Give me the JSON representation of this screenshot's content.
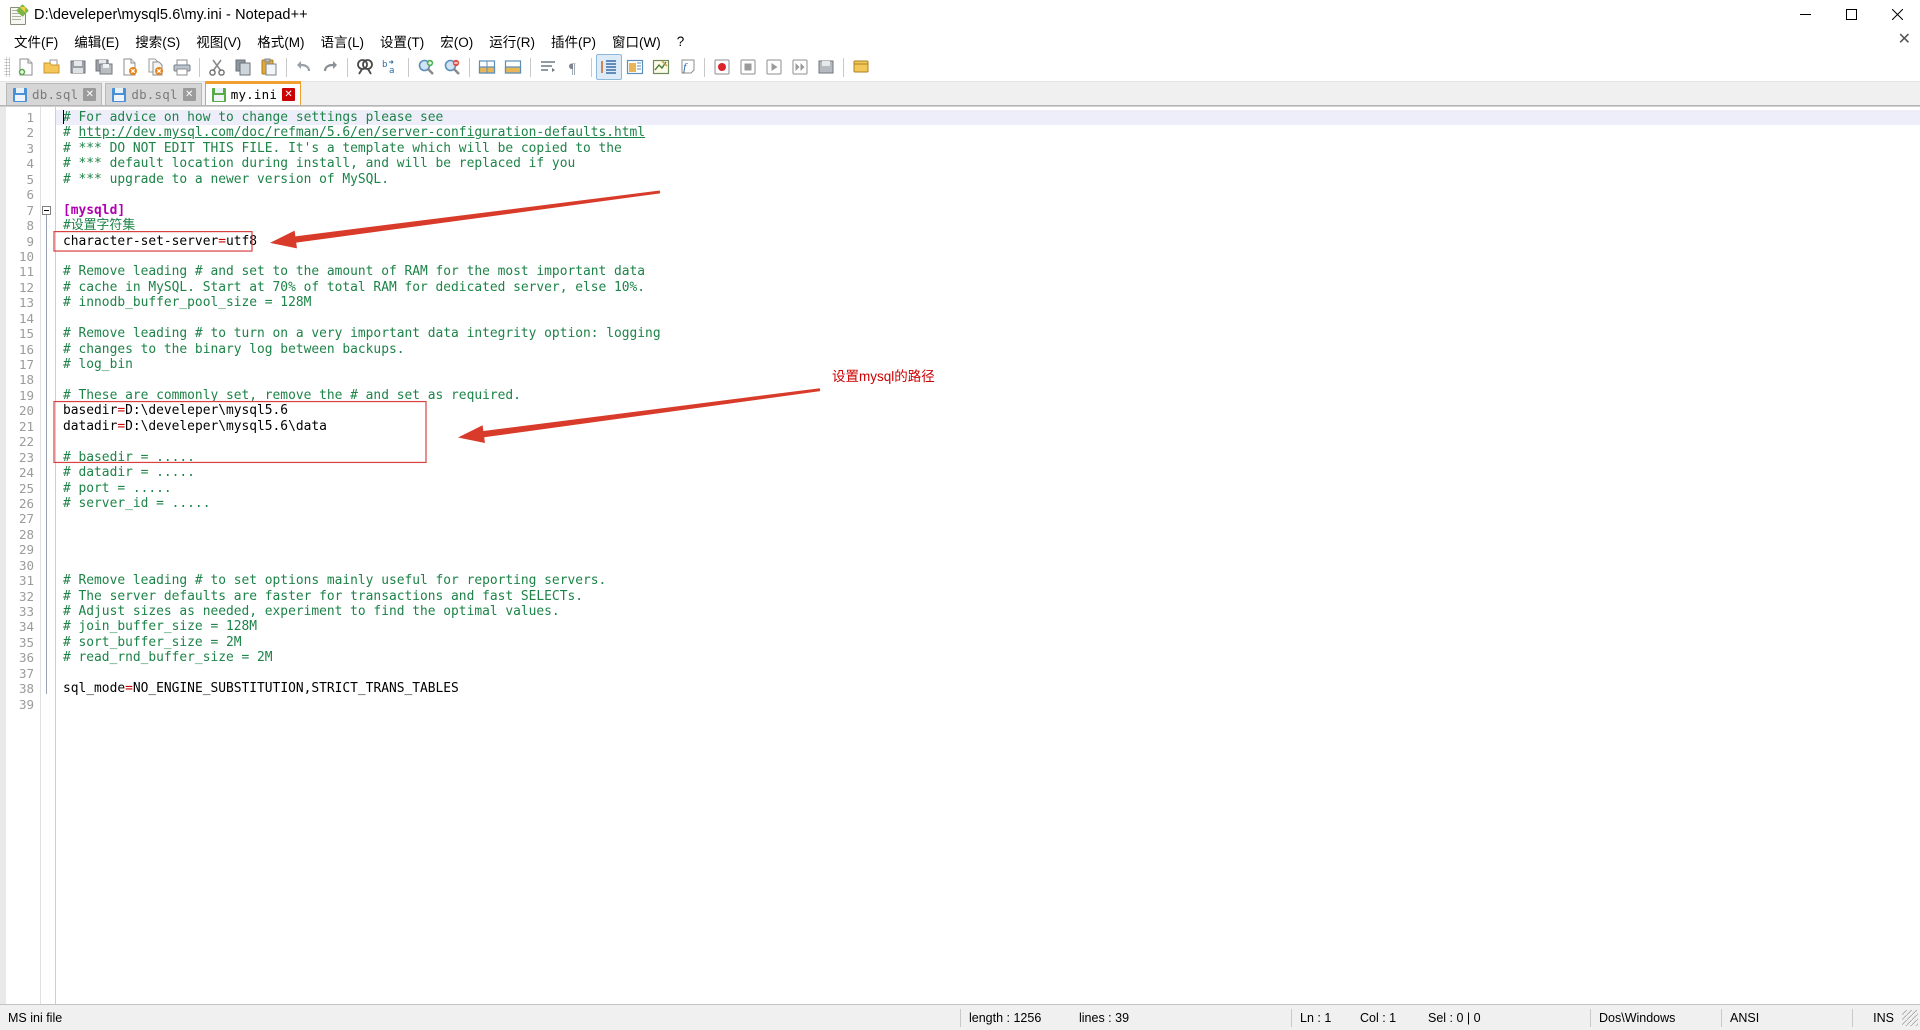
{
  "window": {
    "title": "D:\\develeper\\mysql5.6\\my.ini - Notepad++",
    "icon": "notepad-plus-plus-icon",
    "minimize_label": "—",
    "maximize_label": "❐",
    "close_label": "✕"
  },
  "menubar": {
    "items": [
      {
        "label": "文件(F)",
        "name": "menu-file"
      },
      {
        "label": "编辑(E)",
        "name": "menu-edit"
      },
      {
        "label": "搜索(S)",
        "name": "menu-search"
      },
      {
        "label": "视图(V)",
        "name": "menu-view"
      },
      {
        "label": "格式(M)",
        "name": "menu-format"
      },
      {
        "label": "语言(L)",
        "name": "menu-language"
      },
      {
        "label": "设置(T)",
        "name": "menu-settings"
      },
      {
        "label": "宏(O)",
        "name": "menu-macro"
      },
      {
        "label": "运行(R)",
        "name": "menu-run"
      },
      {
        "label": "插件(P)",
        "name": "menu-plugins"
      },
      {
        "label": "窗口(W)",
        "name": "menu-window"
      },
      {
        "label": "?",
        "name": "menu-help"
      }
    ],
    "close_doc_label": "✕"
  },
  "toolbar": {
    "buttons": [
      {
        "name": "new-file-icon",
        "glyph": "new"
      },
      {
        "name": "open-file-icon",
        "glyph": "open"
      },
      {
        "name": "save-icon",
        "glyph": "save"
      },
      {
        "name": "save-all-icon",
        "glyph": "saveall"
      },
      {
        "name": "close-document-icon",
        "glyph": "closedoc"
      },
      {
        "name": "close-all-documents-icon",
        "glyph": "closeall"
      },
      {
        "name": "print-icon",
        "glyph": "print"
      },
      {
        "name": "separator",
        "glyph": "sep"
      },
      {
        "name": "cut-icon",
        "glyph": "cut"
      },
      {
        "name": "copy-icon",
        "glyph": "copy"
      },
      {
        "name": "paste-icon",
        "glyph": "paste"
      },
      {
        "name": "separator",
        "glyph": "sep"
      },
      {
        "name": "undo-icon",
        "glyph": "undo"
      },
      {
        "name": "redo-icon",
        "glyph": "redo"
      },
      {
        "name": "separator",
        "glyph": "sep"
      },
      {
        "name": "find-icon",
        "glyph": "find"
      },
      {
        "name": "replace-icon",
        "glyph": "replace"
      },
      {
        "name": "separator",
        "glyph": "sep"
      },
      {
        "name": "zoom-in-icon",
        "glyph": "zoomin"
      },
      {
        "name": "zoom-out-icon",
        "glyph": "zoomout"
      },
      {
        "name": "separator",
        "glyph": "sep"
      },
      {
        "name": "sync-vertical-scroll-icon",
        "glyph": "syncv"
      },
      {
        "name": "sync-horizontal-scroll-icon",
        "glyph": "synch"
      },
      {
        "name": "separator",
        "glyph": "sep"
      },
      {
        "name": "word-wrap-icon",
        "glyph": "wrap"
      },
      {
        "name": "show-all-characters-icon",
        "glyph": "pilcrow"
      },
      {
        "name": "separator",
        "glyph": "sep"
      },
      {
        "name": "indent-guide-icon",
        "glyph": "indent"
      },
      {
        "name": "user-defined-dialog-icon",
        "glyph": "udl"
      },
      {
        "name": "document-map-icon",
        "glyph": "docmap"
      },
      {
        "name": "function-list-icon",
        "glyph": "funclist"
      },
      {
        "name": "separator",
        "glyph": "sep"
      },
      {
        "name": "start-recording-macro-icon",
        "glyph": "record"
      },
      {
        "name": "stop-recording-macro-icon",
        "glyph": "stop"
      },
      {
        "name": "play-macro-icon",
        "glyph": "play"
      },
      {
        "name": "run-macro-multiple-times-icon",
        "glyph": "playmulti"
      },
      {
        "name": "save-macro-icon",
        "glyph": "savemacro"
      },
      {
        "name": "separator",
        "glyph": "sep"
      },
      {
        "name": "run-icon",
        "glyph": "run"
      }
    ]
  },
  "tabs": [
    {
      "label": "db.sql",
      "active": false,
      "close_label": "✕",
      "name": "tab-db-sql-1"
    },
    {
      "label": "db.sql",
      "active": false,
      "close_label": "✕",
      "name": "tab-db-sql-2"
    },
    {
      "label": "my.ini",
      "active": true,
      "close_label": "✕",
      "name": "tab-my-ini"
    }
  ],
  "editor": {
    "total_lines": 39,
    "current_line": 1,
    "lines": [
      {
        "n": 1,
        "tokens": [
          {
            "t": "# For advice on how to change settings please see",
            "c": "c-comment"
          }
        ]
      },
      {
        "n": 2,
        "tokens": [
          {
            "t": "# ",
            "c": "c-comment"
          },
          {
            "t": "http://dev.mysql.com/doc/refman/5.6/en/server-configuration-defaults.html",
            "c": "c-link"
          }
        ]
      },
      {
        "n": 3,
        "tokens": [
          {
            "t": "# *** DO NOT EDIT THIS FILE. It's a template which will be copied to the",
            "c": "c-comment"
          }
        ]
      },
      {
        "n": 4,
        "tokens": [
          {
            "t": "# *** default location during install, and will be replaced if you",
            "c": "c-comment"
          }
        ]
      },
      {
        "n": 5,
        "tokens": [
          {
            "t": "# *** upgrade to a newer version of MySQL.",
            "c": "c-comment"
          }
        ]
      },
      {
        "n": 6,
        "tokens": []
      },
      {
        "n": 7,
        "tokens": [
          {
            "t": "[mysqld]",
            "c": "c-section"
          }
        ]
      },
      {
        "n": 8,
        "tokens": [
          {
            "t": "#设置字符集",
            "c": "c-comment"
          }
        ]
      },
      {
        "n": 9,
        "tokens": [
          {
            "t": "character-set-server",
            "c": "c-key"
          },
          {
            "t": "=",
            "c": "c-op"
          },
          {
            "t": "utf8",
            "c": "c-val"
          }
        ]
      },
      {
        "n": 10,
        "tokens": []
      },
      {
        "n": 11,
        "tokens": [
          {
            "t": "# Remove leading # and set to the amount of RAM for the most important data",
            "c": "c-comment"
          }
        ]
      },
      {
        "n": 12,
        "tokens": [
          {
            "t": "# cache in MySQL. Start at 70% of total RAM for dedicated server, else 10%.",
            "c": "c-comment"
          }
        ]
      },
      {
        "n": 13,
        "tokens": [
          {
            "t": "# innodb_buffer_pool_size = 128M",
            "c": "c-comment"
          }
        ]
      },
      {
        "n": 14,
        "tokens": []
      },
      {
        "n": 15,
        "tokens": [
          {
            "t": "# Remove leading # to turn on a very important data integrity option: logging",
            "c": "c-comment"
          }
        ]
      },
      {
        "n": 16,
        "tokens": [
          {
            "t": "# changes to the binary log between backups.",
            "c": "c-comment"
          }
        ]
      },
      {
        "n": 17,
        "tokens": [
          {
            "t": "# log_bin",
            "c": "c-comment"
          }
        ]
      },
      {
        "n": 18,
        "tokens": []
      },
      {
        "n": 19,
        "tokens": [
          {
            "t": "# These are commonly set, remove the # and set as required.",
            "c": "c-comment"
          }
        ]
      },
      {
        "n": 20,
        "tokens": [
          {
            "t": "basedir",
            "c": "c-key"
          },
          {
            "t": "=",
            "c": "c-op"
          },
          {
            "t": "D:\\develeper\\mysql5.6",
            "c": "c-val"
          }
        ]
      },
      {
        "n": 21,
        "tokens": [
          {
            "t": "datadir",
            "c": "c-key"
          },
          {
            "t": "=",
            "c": "c-op"
          },
          {
            "t": "D:\\develeper\\mysql5.6\\data",
            "c": "c-val"
          }
        ]
      },
      {
        "n": 22,
        "tokens": []
      },
      {
        "n": 23,
        "tokens": [
          {
            "t": "# basedir = .....",
            "c": "c-comment"
          }
        ]
      },
      {
        "n": 24,
        "tokens": [
          {
            "t": "# datadir = .....",
            "c": "c-comment"
          }
        ]
      },
      {
        "n": 25,
        "tokens": [
          {
            "t": "# port = .....",
            "c": "c-comment"
          }
        ]
      },
      {
        "n": 26,
        "tokens": [
          {
            "t": "# server_id = .....",
            "c": "c-comment"
          }
        ]
      },
      {
        "n": 27,
        "tokens": []
      },
      {
        "n": 28,
        "tokens": []
      },
      {
        "n": 29,
        "tokens": []
      },
      {
        "n": 30,
        "tokens": []
      },
      {
        "n": 31,
        "tokens": [
          {
            "t": "# Remove leading # to set options mainly useful for reporting servers.",
            "c": "c-comment"
          }
        ]
      },
      {
        "n": 32,
        "tokens": [
          {
            "t": "# The server defaults are faster for transactions and fast SELECTs.",
            "c": "c-comment"
          }
        ]
      },
      {
        "n": 33,
        "tokens": [
          {
            "t": "# Adjust sizes as needed, experiment to find the optimal values.",
            "c": "c-comment"
          }
        ]
      },
      {
        "n": 34,
        "tokens": [
          {
            "t": "# join_buffer_size = 128M",
            "c": "c-comment"
          }
        ]
      },
      {
        "n": 35,
        "tokens": [
          {
            "t": "# sort_buffer_size = 2M",
            "c": "c-comment"
          }
        ]
      },
      {
        "n": 36,
        "tokens": [
          {
            "t": "# read_rnd_buffer_size = 2M",
            "c": "c-comment"
          }
        ]
      },
      {
        "n": 37,
        "tokens": []
      },
      {
        "n": 38,
        "tokens": [
          {
            "t": "sql_mode",
            "c": "c-key"
          },
          {
            "t": "=",
            "c": "c-op"
          },
          {
            "t": "NO_ENGINE_SUBSTITUTION,STRICT_TRANS_TABLES",
            "c": "c-val"
          }
        ]
      },
      {
        "n": 39,
        "tokens": []
      }
    ]
  },
  "annotations": {
    "color": "#cc0000",
    "box_color": "#d94141",
    "charset_note": "",
    "path_note": "设置mysql的路径"
  },
  "statusbar": {
    "file_type": "MS ini file",
    "length": "length : 1256",
    "lines": "lines : 39",
    "ln": "Ln : 1",
    "col": "Col : 1",
    "sel": "Sel : 0 | 0",
    "eol": "Dos\\Windows",
    "encoding": "ANSI",
    "insert_mode": "INS"
  }
}
